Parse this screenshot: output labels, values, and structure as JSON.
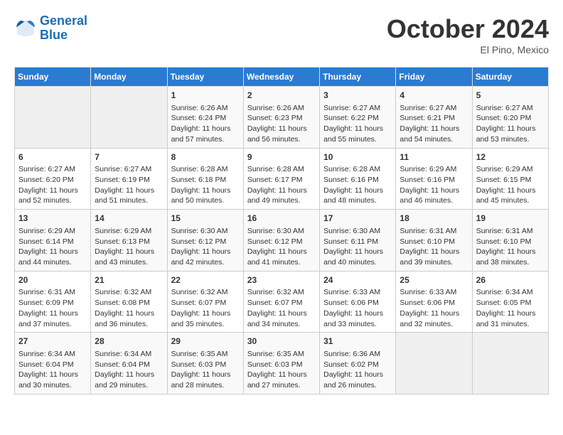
{
  "header": {
    "logo_line1": "General",
    "logo_line2": "Blue",
    "month": "October 2024",
    "location": "El Pino, Mexico"
  },
  "days_of_week": [
    "Sunday",
    "Monday",
    "Tuesday",
    "Wednesday",
    "Thursday",
    "Friday",
    "Saturday"
  ],
  "weeks": [
    [
      {
        "day": "",
        "empty": true
      },
      {
        "day": "",
        "empty": true
      },
      {
        "day": "1",
        "sunrise": "Sunrise: 6:26 AM",
        "sunset": "Sunset: 6:24 PM",
        "daylight": "Daylight: 11 hours and 57 minutes."
      },
      {
        "day": "2",
        "sunrise": "Sunrise: 6:26 AM",
        "sunset": "Sunset: 6:23 PM",
        "daylight": "Daylight: 11 hours and 56 minutes."
      },
      {
        "day": "3",
        "sunrise": "Sunrise: 6:27 AM",
        "sunset": "Sunset: 6:22 PM",
        "daylight": "Daylight: 11 hours and 55 minutes."
      },
      {
        "day": "4",
        "sunrise": "Sunrise: 6:27 AM",
        "sunset": "Sunset: 6:21 PM",
        "daylight": "Daylight: 11 hours and 54 minutes."
      },
      {
        "day": "5",
        "sunrise": "Sunrise: 6:27 AM",
        "sunset": "Sunset: 6:20 PM",
        "daylight": "Daylight: 11 hours and 53 minutes."
      }
    ],
    [
      {
        "day": "6",
        "sunrise": "Sunrise: 6:27 AM",
        "sunset": "Sunset: 6:20 PM",
        "daylight": "Daylight: 11 hours and 52 minutes."
      },
      {
        "day": "7",
        "sunrise": "Sunrise: 6:27 AM",
        "sunset": "Sunset: 6:19 PM",
        "daylight": "Daylight: 11 hours and 51 minutes."
      },
      {
        "day": "8",
        "sunrise": "Sunrise: 6:28 AM",
        "sunset": "Sunset: 6:18 PM",
        "daylight": "Daylight: 11 hours and 50 minutes."
      },
      {
        "day": "9",
        "sunrise": "Sunrise: 6:28 AM",
        "sunset": "Sunset: 6:17 PM",
        "daylight": "Daylight: 11 hours and 49 minutes."
      },
      {
        "day": "10",
        "sunrise": "Sunrise: 6:28 AM",
        "sunset": "Sunset: 6:16 PM",
        "daylight": "Daylight: 11 hours and 48 minutes."
      },
      {
        "day": "11",
        "sunrise": "Sunrise: 6:29 AM",
        "sunset": "Sunset: 6:16 PM",
        "daylight": "Daylight: 11 hours and 46 minutes."
      },
      {
        "day": "12",
        "sunrise": "Sunrise: 6:29 AM",
        "sunset": "Sunset: 6:15 PM",
        "daylight": "Daylight: 11 hours and 45 minutes."
      }
    ],
    [
      {
        "day": "13",
        "sunrise": "Sunrise: 6:29 AM",
        "sunset": "Sunset: 6:14 PM",
        "daylight": "Daylight: 11 hours and 44 minutes."
      },
      {
        "day": "14",
        "sunrise": "Sunrise: 6:29 AM",
        "sunset": "Sunset: 6:13 PM",
        "daylight": "Daylight: 11 hours and 43 minutes."
      },
      {
        "day": "15",
        "sunrise": "Sunrise: 6:30 AM",
        "sunset": "Sunset: 6:12 PM",
        "daylight": "Daylight: 11 hours and 42 minutes."
      },
      {
        "day": "16",
        "sunrise": "Sunrise: 6:30 AM",
        "sunset": "Sunset: 6:12 PM",
        "daylight": "Daylight: 11 hours and 41 minutes."
      },
      {
        "day": "17",
        "sunrise": "Sunrise: 6:30 AM",
        "sunset": "Sunset: 6:11 PM",
        "daylight": "Daylight: 11 hours and 40 minutes."
      },
      {
        "day": "18",
        "sunrise": "Sunrise: 6:31 AM",
        "sunset": "Sunset: 6:10 PM",
        "daylight": "Daylight: 11 hours and 39 minutes."
      },
      {
        "day": "19",
        "sunrise": "Sunrise: 6:31 AM",
        "sunset": "Sunset: 6:10 PM",
        "daylight": "Daylight: 11 hours and 38 minutes."
      }
    ],
    [
      {
        "day": "20",
        "sunrise": "Sunrise: 6:31 AM",
        "sunset": "Sunset: 6:09 PM",
        "daylight": "Daylight: 11 hours and 37 minutes."
      },
      {
        "day": "21",
        "sunrise": "Sunrise: 6:32 AM",
        "sunset": "Sunset: 6:08 PM",
        "daylight": "Daylight: 11 hours and 36 minutes."
      },
      {
        "day": "22",
        "sunrise": "Sunrise: 6:32 AM",
        "sunset": "Sunset: 6:07 PM",
        "daylight": "Daylight: 11 hours and 35 minutes."
      },
      {
        "day": "23",
        "sunrise": "Sunrise: 6:32 AM",
        "sunset": "Sunset: 6:07 PM",
        "daylight": "Daylight: 11 hours and 34 minutes."
      },
      {
        "day": "24",
        "sunrise": "Sunrise: 6:33 AM",
        "sunset": "Sunset: 6:06 PM",
        "daylight": "Daylight: 11 hours and 33 minutes."
      },
      {
        "day": "25",
        "sunrise": "Sunrise: 6:33 AM",
        "sunset": "Sunset: 6:06 PM",
        "daylight": "Daylight: 11 hours and 32 minutes."
      },
      {
        "day": "26",
        "sunrise": "Sunrise: 6:34 AM",
        "sunset": "Sunset: 6:05 PM",
        "daylight": "Daylight: 11 hours and 31 minutes."
      }
    ],
    [
      {
        "day": "27",
        "sunrise": "Sunrise: 6:34 AM",
        "sunset": "Sunset: 6:04 PM",
        "daylight": "Daylight: 11 hours and 30 minutes."
      },
      {
        "day": "28",
        "sunrise": "Sunrise: 6:34 AM",
        "sunset": "Sunset: 6:04 PM",
        "daylight": "Daylight: 11 hours and 29 minutes."
      },
      {
        "day": "29",
        "sunrise": "Sunrise: 6:35 AM",
        "sunset": "Sunset: 6:03 PM",
        "daylight": "Daylight: 11 hours and 28 minutes."
      },
      {
        "day": "30",
        "sunrise": "Sunrise: 6:35 AM",
        "sunset": "Sunset: 6:03 PM",
        "daylight": "Daylight: 11 hours and 27 minutes."
      },
      {
        "day": "31",
        "sunrise": "Sunrise: 6:36 AM",
        "sunset": "Sunset: 6:02 PM",
        "daylight": "Daylight: 11 hours and 26 minutes."
      },
      {
        "day": "",
        "empty": true
      },
      {
        "day": "",
        "empty": true
      }
    ]
  ]
}
